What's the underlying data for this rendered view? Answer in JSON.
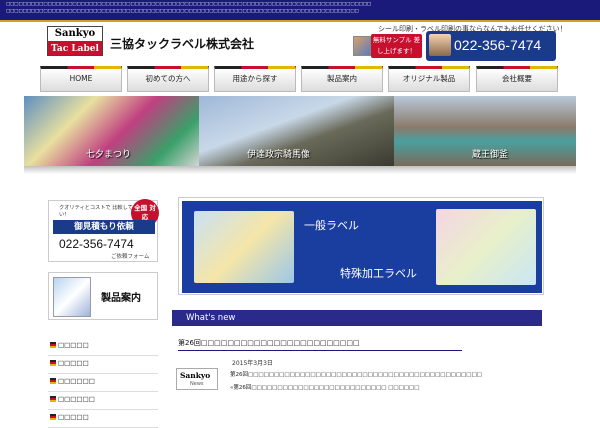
{
  "topbar": {
    "text": "□□□□□□□□□□□□□□□□□□□□□□□□□□□□□□□□□□□□□□□□□□□□□□□□□□□□□□□□□□□□□□□□□□□□□□□□□□□□□□□□□□□□□□□□ □□□□□□□□□□□□□□□□□□□□□□□□□□□□□□□□□□□□□□□□□□□□□□□□□□□□□□□□□□□□□□□□□□□□□□□□□□□□□□□□□□□□□"
  },
  "header": {
    "logo_line1": "Sankyo",
    "logo_line2": "Tac Label",
    "company": "三協タックラベル株式会社",
    "tagline": "シール印刷・ラベル印刷の事ならなんでもお任せください！",
    "sample_badge": "無料サンプル 差し上げます！",
    "phone": "022-356-7474"
  },
  "nav": [
    "HOME",
    "初めての方へ",
    "用途から探す",
    "製品案内",
    "オリジナル製品",
    "会社概要"
  ],
  "banner": {
    "captions": [
      "七夕まつり",
      "伊達政宗騎馬像",
      "蔵王御釜"
    ]
  },
  "sidebar": {
    "estimate": {
      "quality": "クオリティとコストで 比較してください！",
      "badge": "全国 対応",
      "title": "御見積もり依頼",
      "phone": "022-356-7474",
      "form": "ご依頼フォーム"
    },
    "products": {
      "label": "製品案内"
    },
    "links": [
      "□□□□□",
      "□□□□□",
      "□□□□□□",
      "□□□□□□",
      "□□□□□"
    ]
  },
  "feature": {
    "title1": "一般ラベル",
    "title2": "特殊加工ラベル"
  },
  "whatsnew": {
    "heading": "What's new"
  },
  "news": {
    "title": "第26回□□□□□□□□□□□□□□□□□□□□□□□□",
    "date": "2015年3月3日",
    "logo_line1": "Sankyo",
    "logo_line2": "News",
    "line1": "第26回□□□□□□□□□□□□□□□□□□□□□□□□□□□□□□□□□□□□□□□□□□□□□",
    "line2": "«第26回□□□□□□□□□□□□□□□□□□□□□□□□□□ □□□□□□"
  },
  "colors": {
    "navy": "#1a1a7a",
    "brand_blue": "#1a3ea0",
    "red": "#c8102e",
    "gold": "#e0b800"
  }
}
